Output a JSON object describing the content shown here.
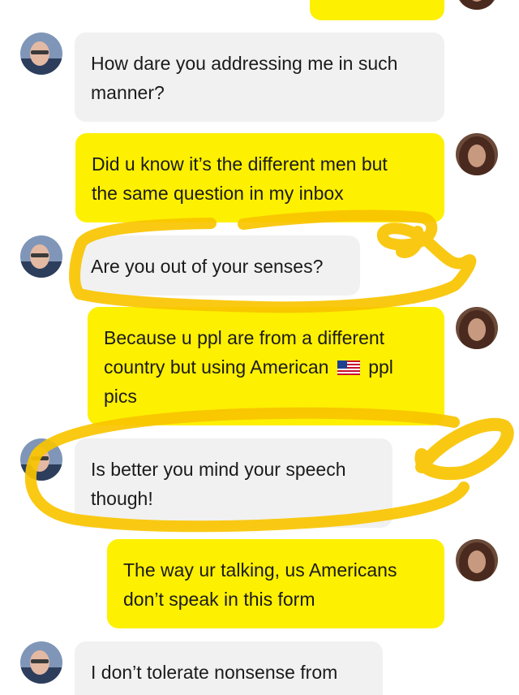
{
  "messages": [
    {
      "id": "m0",
      "side": "out",
      "text": ""
    },
    {
      "id": "m1",
      "side": "in",
      "line1": "How dare you addressing me in such",
      "line2": "manner?"
    },
    {
      "id": "m2",
      "side": "out",
      "line1": "Did u know it’s the different men but",
      "line2": "the same question in my inbox"
    },
    {
      "id": "m3",
      "side": "in",
      "line1": "Are you out of your senses?"
    },
    {
      "id": "m4",
      "side": "out",
      "line1": "Because u ppl are from a different",
      "line2a": "country but using American",
      "line2b": "ppl",
      "line3": "pics",
      "flag_icon": "us-flag-icon"
    },
    {
      "id": "m5",
      "side": "in",
      "line1": "Is better you mind your speech",
      "line2": "though!"
    },
    {
      "id": "m6",
      "side": "out",
      "line1": "The way ur talking, us Americans",
      "line2": "don’t speak in this form"
    },
    {
      "id": "m7",
      "side": "in",
      "line1": "I don’t tolerate nonsense from"
    }
  ],
  "colors": {
    "incoming_bubble": "#f1f1f1",
    "outgoing_bubble": "#fdf000",
    "highlight_scribble": "#f9c400",
    "text": "#1b1b1b"
  },
  "icons": {
    "incoming_avatar": "man-avatar-icon",
    "outgoing_avatar": "woman-avatar-icon"
  }
}
